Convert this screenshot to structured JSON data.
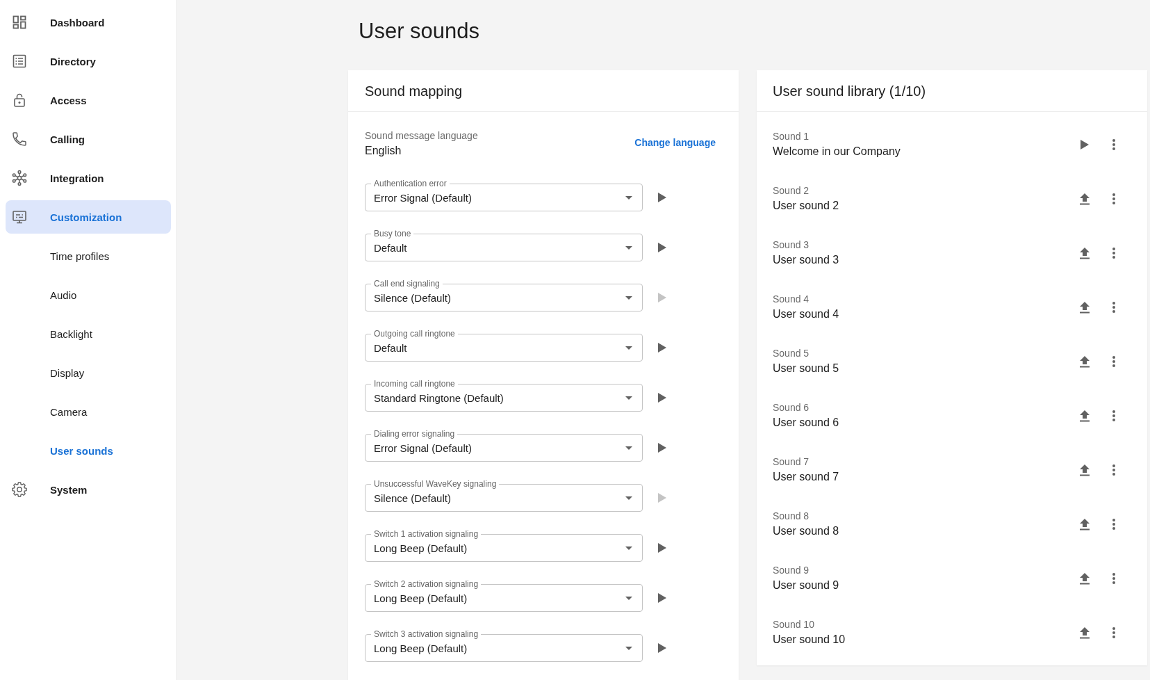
{
  "sidebar": {
    "items": [
      {
        "label": "Dashboard",
        "selected": false
      },
      {
        "label": "Directory",
        "selected": false
      },
      {
        "label": "Access",
        "selected": false
      },
      {
        "label": "Calling",
        "selected": false
      },
      {
        "label": "Integration",
        "selected": false
      },
      {
        "label": "Customization",
        "selected": true,
        "children": [
          {
            "label": "Time profiles",
            "selected": false
          },
          {
            "label": "Audio",
            "selected": false
          },
          {
            "label": "Backlight",
            "selected": false
          },
          {
            "label": "Display",
            "selected": false
          },
          {
            "label": "Camera",
            "selected": false
          },
          {
            "label": "User sounds",
            "selected": true
          }
        ]
      },
      {
        "label": "System",
        "selected": false
      }
    ]
  },
  "page": {
    "title": "User sounds"
  },
  "sound_mapping": {
    "title": "Sound mapping",
    "language": {
      "label": "Sound message language",
      "value": "English",
      "action": "Change language"
    },
    "fields": [
      {
        "label": "Authentication error",
        "value": "Error Signal (Default)",
        "play_disabled": false
      },
      {
        "label": "Busy tone",
        "value": "Default",
        "play_disabled": false
      },
      {
        "label": "Call end signaling",
        "value": "Silence (Default)",
        "play_disabled": true
      },
      {
        "label": "Outgoing call ringtone",
        "value": "Default",
        "play_disabled": false
      },
      {
        "label": "Incoming call ringtone",
        "value": "Standard Ringtone (Default)",
        "play_disabled": false
      },
      {
        "label": "Dialing error signaling",
        "value": "Error Signal (Default)",
        "play_disabled": false
      },
      {
        "label": "Unsuccessful WaveKey signaling",
        "value": "Silence (Default)",
        "play_disabled": true
      },
      {
        "label": "Switch 1 activation signaling",
        "value": "Long Beep (Default)",
        "play_disabled": false
      },
      {
        "label": "Switch 2 activation signaling",
        "value": "Long Beep (Default)",
        "play_disabled": false
      },
      {
        "label": "Switch 3 activation signaling",
        "value": "Long Beep (Default)",
        "play_disabled": false
      }
    ]
  },
  "sound_library": {
    "title": "User sound library (1/10)",
    "sounds": [
      {
        "label": "Sound 1",
        "name": "Welcome in our Company",
        "kind": "play"
      },
      {
        "label": "Sound 2",
        "name": "User sound 2",
        "kind": "upload"
      },
      {
        "label": "Sound 3",
        "name": "User sound 3",
        "kind": "upload"
      },
      {
        "label": "Sound 4",
        "name": "User sound 4",
        "kind": "upload"
      },
      {
        "label": "Sound 5",
        "name": "User sound 5",
        "kind": "upload"
      },
      {
        "label": "Sound 6",
        "name": "User sound 6",
        "kind": "upload"
      },
      {
        "label": "Sound 7",
        "name": "User sound 7",
        "kind": "upload"
      },
      {
        "label": "Sound 8",
        "name": "User sound 8",
        "kind": "upload"
      },
      {
        "label": "Sound 9",
        "name": "User sound 9",
        "kind": "upload"
      },
      {
        "label": "Sound 10",
        "name": "User sound 10",
        "kind": "upload"
      }
    ]
  }
}
